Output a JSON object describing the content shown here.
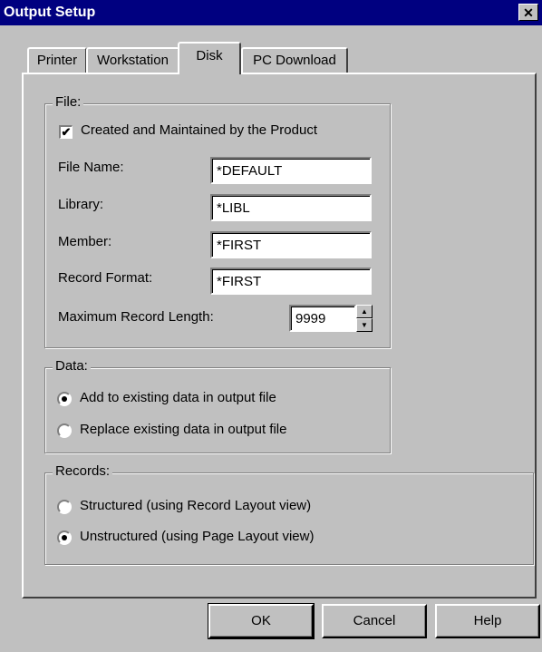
{
  "window": {
    "title": "Output Setup",
    "close_glyph": "✕"
  },
  "tabs": [
    {
      "label": "Printer",
      "active": false
    },
    {
      "label": "Workstation",
      "active": false
    },
    {
      "label": "Disk",
      "active": true
    },
    {
      "label": "PC Download",
      "active": false
    }
  ],
  "file_group": {
    "legend": "File:",
    "created_checkbox": {
      "label": "Created and Maintained by the Product",
      "checked": true,
      "glyph": "✔"
    },
    "file_name": {
      "label": "File Name:",
      "value": "*DEFAULT"
    },
    "library": {
      "label": "Library:",
      "value": "*LIBL"
    },
    "member": {
      "label": "Member:",
      "value": "*FIRST"
    },
    "record_format": {
      "label": "Record Format:",
      "value": "*FIRST"
    },
    "max_record_length": {
      "label": "Maximum Record Length:",
      "value": "9999"
    }
  },
  "data_group": {
    "legend": "Data:",
    "options": [
      {
        "label": "Add to existing data in output file",
        "selected": true
      },
      {
        "label": "Replace existing data in output file",
        "selected": false
      }
    ]
  },
  "records_group": {
    "legend": "Records:",
    "options": [
      {
        "label": "Structured (using Record Layout view)",
        "selected": false
      },
      {
        "label": "Unstructured (using Page Layout view)",
        "selected": true
      }
    ]
  },
  "buttons": {
    "ok": "OK",
    "cancel": "Cancel",
    "help": "Help"
  }
}
